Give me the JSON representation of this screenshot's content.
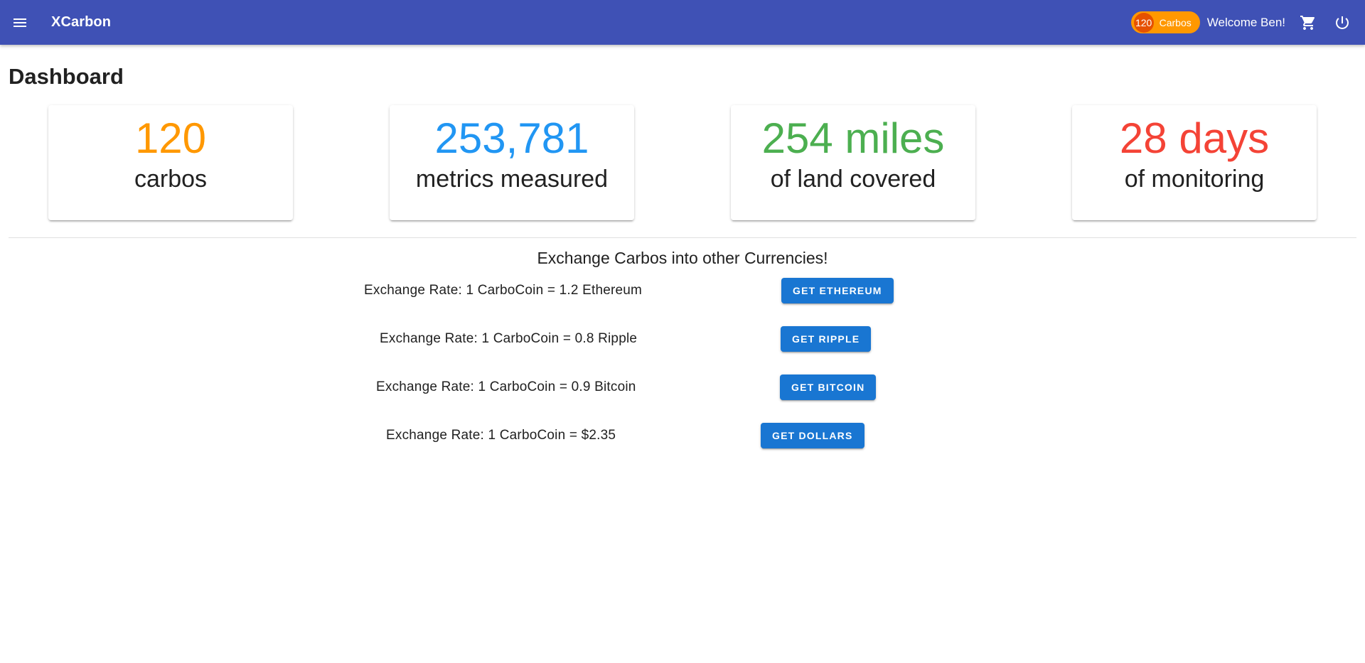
{
  "appbar": {
    "title": "XCarbon",
    "menu_icon": "hamburger-menu-icon",
    "chip_count": "120",
    "chip_label": "Carbos",
    "welcome": "Welcome Ben!",
    "cart_icon": "cart-icon",
    "power_icon": "power-icon",
    "color": "#3f51b5",
    "chip_color": "#ff9800"
  },
  "page": {
    "title": "Dashboard"
  },
  "stats": [
    {
      "value": "120",
      "label": "carbos",
      "color": "#ff9800"
    },
    {
      "value": "253,781",
      "label": "metrics measured",
      "color": "#2196f3"
    },
    {
      "value": "254 miles",
      "label": "of land covered",
      "color": "#4caf50"
    },
    {
      "value": "28 days",
      "label": "of monitoring",
      "color": "#f44336"
    }
  ],
  "exchange": {
    "heading": "Exchange Carbos into other Currencies!",
    "rows": [
      {
        "rate": "Exchange Rate: 1 CarboCoin = 1.2 Ethereum",
        "button": "Get Ethereum"
      },
      {
        "rate": "Exchange Rate: 1 CarboCoin = 0.8 Ripple",
        "button": "Get Ripple"
      },
      {
        "rate": "Exchange Rate: 1 CarboCoin = 0.9 Bitcoin",
        "button": "Get Bitcoin"
      },
      {
        "rate": "Exchange Rate: 1 CarboCoin = $2.35",
        "button": "Get Dollars"
      }
    ],
    "button_color": "#1976d2"
  }
}
